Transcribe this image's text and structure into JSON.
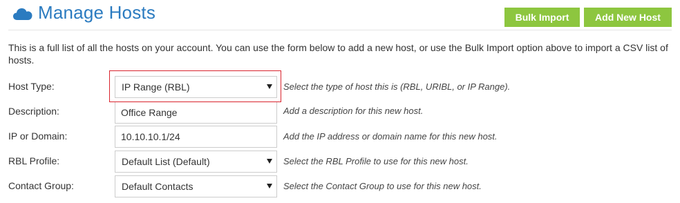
{
  "header": {
    "icon": "cloud-icon",
    "title": "Manage Hosts",
    "accent_color": "#2b7bc0",
    "button_color": "#8dc63f"
  },
  "toolbar": {
    "bulk_import_label": "Bulk Import",
    "add_new_host_label": "Add New Host"
  },
  "intro": "This is a full list of all the hosts on your account. You can use the form below to add a new host, or use the Bulk Import option above to import a CSV list of hosts.",
  "form": {
    "host_type": {
      "label": "Host Type:",
      "value": "IP Range (RBL)",
      "help": "Select the type of host this is (RBL, URIBL, or IP Range)."
    },
    "description": {
      "label": "Description:",
      "value": "Office Range",
      "help": "Add a description for this new host."
    },
    "ip_or_domain": {
      "label": "IP or Domain:",
      "value": "10.10.10.1/24",
      "help": "Add the IP address or domain name for this new host."
    },
    "rbl_profile": {
      "label": "RBL Profile:",
      "value": "Default List (Default)",
      "help": "Select the RBL Profile to use for this new host."
    },
    "contact_group": {
      "label": "Contact Group:",
      "value": "Default Contacts",
      "help": "Select the Contact Group to use for this new host."
    }
  },
  "highlight_color": "#d9232d"
}
